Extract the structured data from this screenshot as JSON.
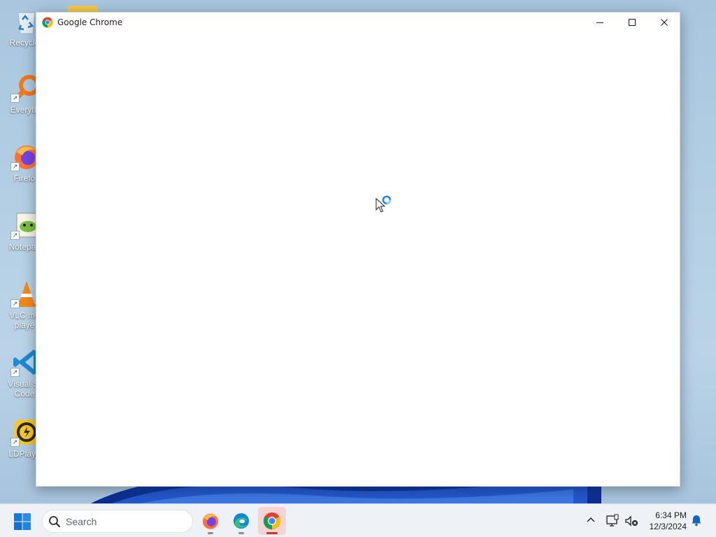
{
  "window": {
    "title": "Google Chrome",
    "minimize_icon": "minimize-icon",
    "maximize_icon": "maximize-icon",
    "close_icon": "close-icon"
  },
  "desktop": {
    "icons": [
      {
        "label": "Recycle",
        "icon": "recycle-bin-icon"
      },
      {
        "label": "Everyth",
        "icon": "everything-search-icon"
      },
      {
        "label": "Firefo",
        "icon": "firefox-icon"
      },
      {
        "label": "Notepac",
        "icon": "notepad-plus-plus-icon"
      },
      {
        "label": "VLC me\nplaye",
        "icon": "vlc-icon"
      },
      {
        "label": "Visual St\nCode",
        "icon": "vscode-icon"
      },
      {
        "label": "LDPlaye",
        "icon": "ldplayer-icon"
      }
    ]
  },
  "taskbar": {
    "search_placeholder": "Search",
    "apps": [
      {
        "name": "Firefox",
        "icon": "firefox-icon"
      },
      {
        "name": "Microsoft Edge",
        "icon": "edge-icon"
      },
      {
        "name": "Google Chrome",
        "icon": "chrome-icon",
        "active": true
      }
    ],
    "clock": {
      "time": "6:34 PM",
      "date": "12/3/2024"
    }
  },
  "colors": {
    "wallpaper": "#b4cfe4",
    "taskbar": "#eef2f6",
    "active_app_highlight": "#f7d4d4",
    "cursor_ring": "#1e88e5"
  }
}
